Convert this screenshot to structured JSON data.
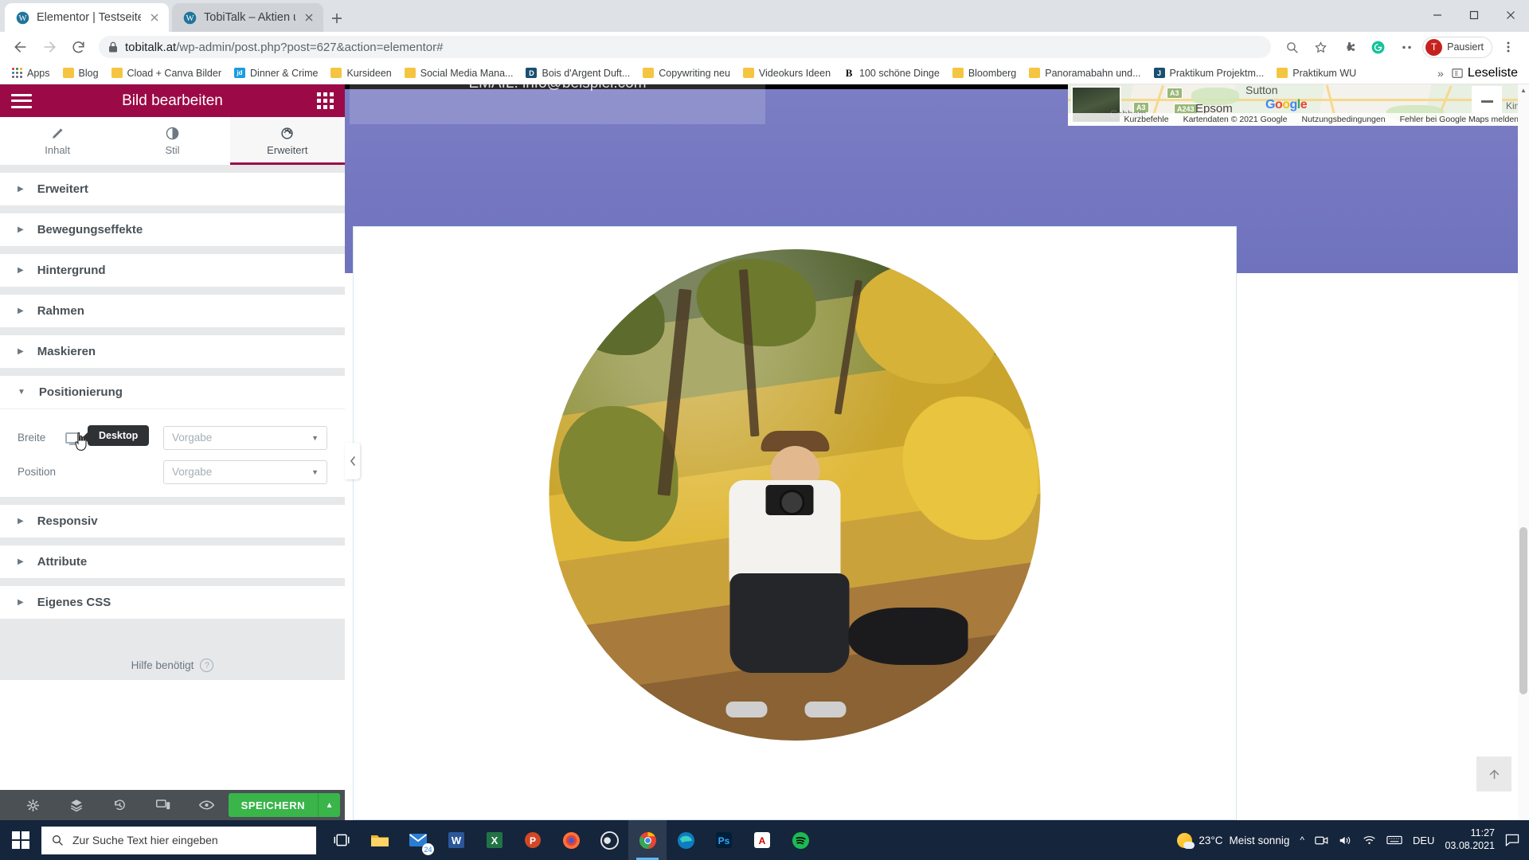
{
  "browser": {
    "tabs": [
      {
        "title": "Elementor | Testseite",
        "favicon": "wordpress-icon",
        "active": true
      },
      {
        "title": "TobiTalk – Aktien und persönliche",
        "favicon": "wordpress-icon",
        "active": false
      }
    ],
    "new_tab_label": "+",
    "window_controls": [
      "minimize",
      "maximize",
      "close"
    ],
    "nav": {
      "back": "back-arrow",
      "forward": "forward-arrow",
      "reload": "reload-icon"
    },
    "address": {
      "lock": "lock-icon",
      "host": "tobitalk.at",
      "path": "/wp-admin/post.php?post=627&action=elementor#",
      "full": "tobitalk.at/wp-admin/post.php?post=627&action=elementor#"
    },
    "omnibox_icons": [
      "zoom-icon",
      "bookmark-star-icon",
      "extension-puzzle-icon",
      "grammarly-icon",
      "extensions-icon"
    ],
    "profile": {
      "initial": "T",
      "label": "Pausiert"
    },
    "bookmarks": [
      {
        "label": "Apps",
        "icon": "apps-grid-icon"
      },
      {
        "label": "Blog",
        "icon": "folder-icon"
      },
      {
        "label": "Cload + Canva Bilder",
        "icon": "folder-icon"
      },
      {
        "label": "Dinner & Crime",
        "icon": "jd-icon"
      },
      {
        "label": "Kursideen",
        "icon": "folder-icon"
      },
      {
        "label": "Social Media Mana...",
        "icon": "folder-icon"
      },
      {
        "label": "Bois d'Argent Duft...",
        "icon": "dior-icon"
      },
      {
        "label": "Copywriting neu",
        "icon": "folder-icon"
      },
      {
        "label": "Videokurs Ideen",
        "icon": "folder-icon"
      },
      {
        "label": "100 schöne Dinge",
        "icon": "b-serif-icon"
      },
      {
        "label": "Bloomberg",
        "icon": "folder-icon"
      },
      {
        "label": "Panoramabahn und...",
        "icon": "folder-icon"
      },
      {
        "label": "Praktikum Projektm...",
        "icon": "jobs-icon"
      },
      {
        "label": "Praktikum WU",
        "icon": "folder-icon"
      }
    ],
    "bookmarks_overflow": "»",
    "reading_list": "Leseliste"
  },
  "panel": {
    "title": "Bild bearbeiten",
    "menu_icon": "hamburger-icon",
    "apps_icon": "apps-grid-icon",
    "tabs": [
      {
        "label": "Inhalt",
        "icon": "pencil-icon",
        "active": false
      },
      {
        "label": "Stil",
        "icon": "contrast-icon",
        "active": false
      },
      {
        "label": "Erweitert",
        "icon": "gear-icon",
        "active": true
      }
    ],
    "sections": [
      {
        "label": "Erweitert",
        "open": false
      },
      {
        "label": "Bewegungseffekte",
        "open": false
      },
      {
        "label": "Hintergrund",
        "open": false
      },
      {
        "label": "Rahmen",
        "open": false
      },
      {
        "label": "Maskieren",
        "open": false
      },
      {
        "label": "Positionierung",
        "open": true
      },
      {
        "label": "Responsiv",
        "open": false
      },
      {
        "label": "Attribute",
        "open": false
      },
      {
        "label": "Eigenes CSS",
        "open": false
      }
    ],
    "positioning": {
      "width": {
        "label": "Breite",
        "value": "Vorgabe",
        "device_icon": "desktop-monitor-icon"
      },
      "position": {
        "label": "Position",
        "value": "Vorgabe"
      }
    },
    "tooltip": {
      "text": "Desktop"
    },
    "help": {
      "label": "Hilfe benötigt",
      "icon": "question-circle-icon"
    },
    "footer_icons": [
      "gear-icon",
      "layers-icon",
      "history-icon",
      "responsive-devices-icon",
      "eye-preview-icon"
    ],
    "save_button": {
      "label": "SPEICHERN",
      "caret": "▲",
      "color": "#39b54a"
    },
    "collapse_handle": "chevron-left-icon",
    "accent_color": "#9b0a46"
  },
  "canvas": {
    "hero_email": "EMAIL: info@beispiel.com",
    "map": {
      "logo_letters": [
        "G",
        "o",
        "o",
        "g",
        "l",
        "e"
      ],
      "cities": [
        "Cobham",
        "Epsom",
        "Sutton",
        "Kings"
      ],
      "road_badges": [
        "A3",
        "A243",
        "A3"
      ],
      "footer_links": [
        "Kurzbefehle",
        "Kartendaten © 2021 Google",
        "Nutzungsbedingungen",
        "Fehler bei Google Maps melden"
      ],
      "zoom_control": "minus-icon"
    },
    "image_widget": {
      "alt": "photographer-with-dog-autumn-circle",
      "shape": "circle"
    },
    "scroll_top_button": "scroll-to-top-icon"
  },
  "taskbar": {
    "start": "windows-logo-icon",
    "search_placeholder": "Zur Suche Text hier eingeben",
    "search_icon": "search-icon",
    "items": [
      {
        "name": "task-view-icon"
      },
      {
        "name": "file-explorer-icon"
      },
      {
        "name": "mail-icon",
        "badge": "24"
      },
      {
        "name": "word-icon"
      },
      {
        "name": "excel-icon"
      },
      {
        "name": "powerpoint-icon"
      },
      {
        "name": "firefox-icon"
      },
      {
        "name": "obs-icon"
      },
      {
        "name": "chrome-icon",
        "active": true
      },
      {
        "name": "edge-icon"
      },
      {
        "name": "photoshop-icon"
      },
      {
        "name": "acrobat-icon"
      },
      {
        "name": "spotify-icon"
      }
    ],
    "tray": {
      "weather_temp": "23°C",
      "weather_desc": "Meist sonnig",
      "weather_icon": "sun-cloud-icon",
      "overflow": "^",
      "icons": [
        "camera-icon",
        "volume-icon",
        "wifi-icon",
        "keyboard-icon"
      ],
      "language": "DEU",
      "time": "11:27",
      "date": "03.08.2021",
      "action_center": "notification-icon"
    }
  }
}
